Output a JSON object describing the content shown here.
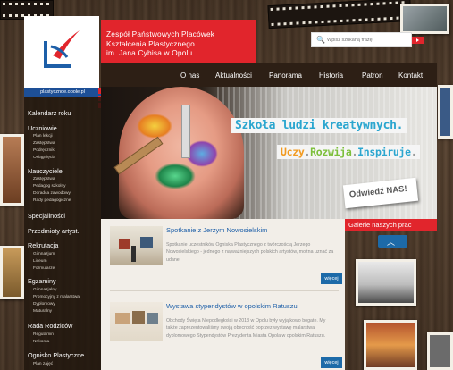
{
  "header": {
    "title_lines": [
      "Zespół Państwowych Placówek",
      "Kształcenia Plastycznego",
      "im. Jana Cybisa w Opolu"
    ]
  },
  "search": {
    "placeholder": "Wpisz szukaną frazę"
  },
  "topnav": {
    "items": [
      "O nas",
      "Aktualności",
      "Panorama",
      "Historia",
      "Patron",
      "Kontakt"
    ]
  },
  "linkbar": {
    "label": "plastycznoe.opole.pl"
  },
  "sidebar": {
    "sections": [
      {
        "label": "Kalendarz roku",
        "items": []
      },
      {
        "label": "Uczniowie",
        "items": [
          "Plan lekcji",
          "Zastępstwa",
          "Podręczniki",
          "Osiągnięcia"
        ]
      },
      {
        "label": "Nauczyciele",
        "items": [
          "Zastępstwa",
          "Pedagog szkolny",
          "Doradca zawodowy",
          "Rady pedagogiczne"
        ]
      },
      {
        "label": "Specjaliności",
        "items": []
      },
      {
        "label": "Przedmioty artyst.",
        "items": []
      },
      {
        "label": "Rekrutacja",
        "items": [
          "Gimnazjum",
          "Liceum",
          "Formularze"
        ]
      },
      {
        "label": "Egzaminy",
        "items": [
          "Gimnazjalny",
          "Promocyjny z malarstwa",
          "Dyplomowy",
          "Maturalny"
        ]
      },
      {
        "label": "Rada Rodziców",
        "items": [
          "Regulamin",
          "Nr konta"
        ]
      },
      {
        "label": "Ognisko Plastyczne",
        "items": [
          "Plan zajęć"
        ]
      }
    ]
  },
  "hero": {
    "slogan_main": "Szkoła ludzi kreatywnych.",
    "slogan_words": [
      "Uczy",
      ".",
      "Rozwija",
      ".",
      "Inspiruje",
      "."
    ],
    "sign_text": "Odwiedź NAS!"
  },
  "gallery": {
    "label": "Galerie naszych prac",
    "scroll_up": "︿"
  },
  "news": [
    {
      "title": "Spotkanie z Jerzym Nowosielskim",
      "body": "Spotkanie uczestników Ogniska Plastycznego z twórczością Jerzego Nowosielskiego - jednego z najważniejszych polskich artystów, można uznać za udane",
      "more": "więcej"
    },
    {
      "title": "Wystawa stypendystów w opolskim Ratuszu",
      "body": "Obchody Święta Niepodległości w 2013 w Opolu były wyjątkowo bogate. My także zaprezentowaliśmy swoją obecność poprzez wystawę malarstwa dyplomowego Stypendystów Prezydenta Miasta Opola w opolskim Ratuszu.",
      "more": "więcej"
    }
  ],
  "colors": {
    "accent_red": "#e1252c",
    "nav_dark": "#2d1f15",
    "link_blue": "#1d5fa8",
    "slogan_blue": "#2ba6cf",
    "slogan_orange": "#f29a1f",
    "slogan_green": "#7cbf3a"
  }
}
